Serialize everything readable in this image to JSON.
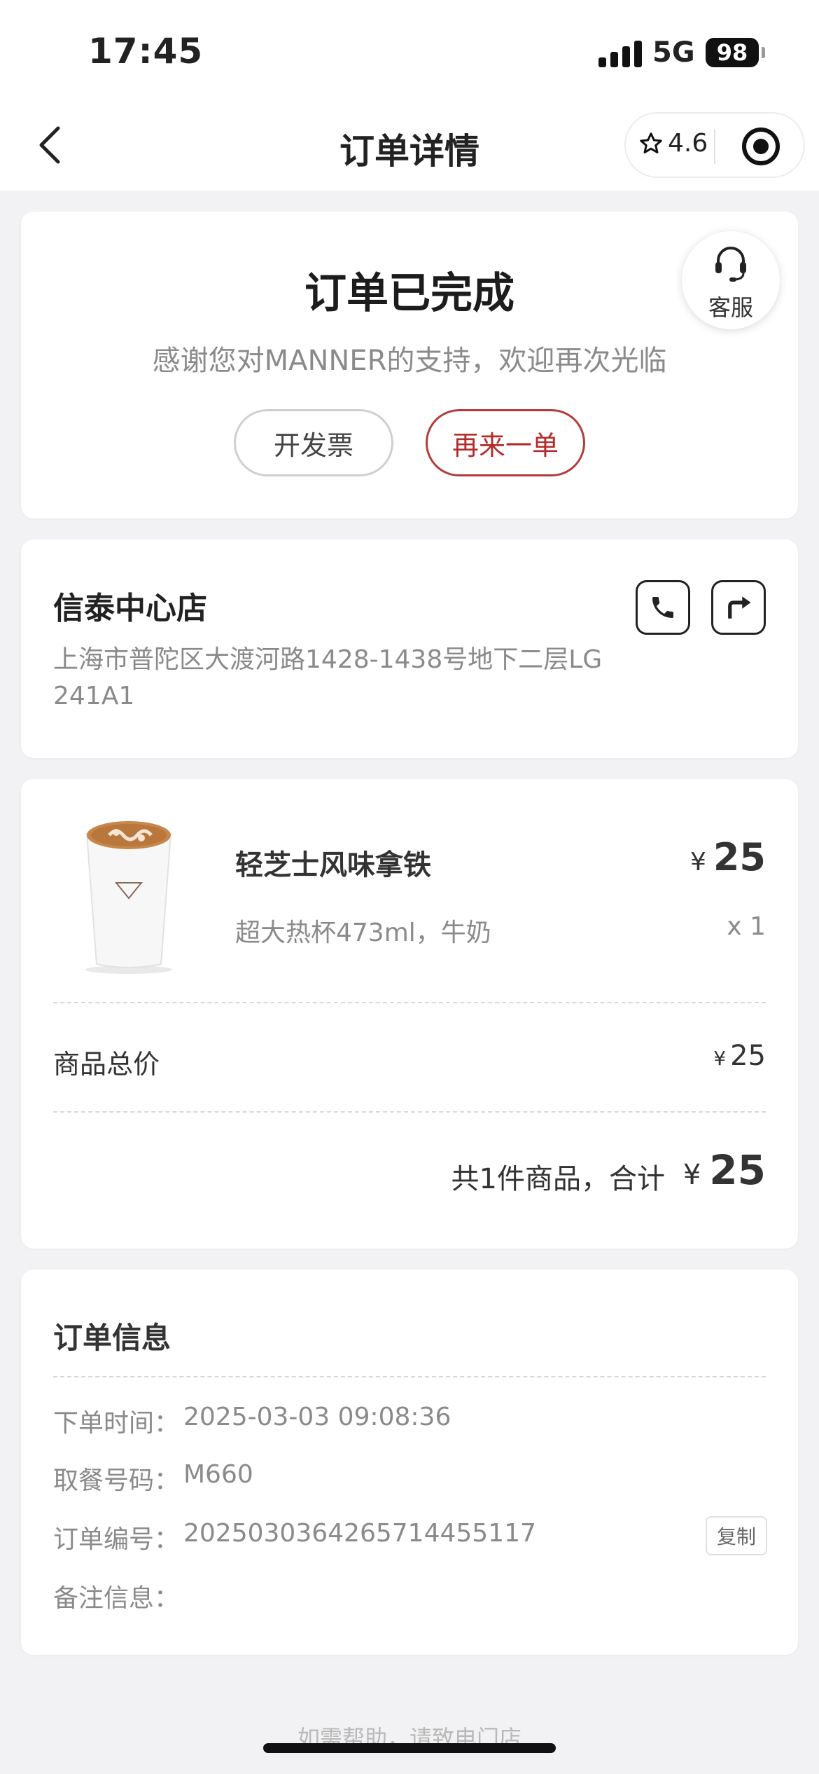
{
  "status_bar": {
    "time": "17:45",
    "network": "5G",
    "battery": "98"
  },
  "nav": {
    "title": "订单详情",
    "rating": "4.6"
  },
  "order_status": {
    "title": "订单已完成",
    "subtitle": "感谢您对MANNER的支持，欢迎再次光临",
    "invoice_label": "开发票",
    "reorder_label": "再来一单",
    "service_label": "客服"
  },
  "store": {
    "name": "信泰中心店",
    "address": "上海市普陀区大渡河路1428-1438号地下二层LG 241A1"
  },
  "product": {
    "name": "轻芝士风味拿铁",
    "currency": "¥",
    "price": "25",
    "spec": "超大热杯473ml，牛奶",
    "qty": "x 1"
  },
  "summary": {
    "subtotal_label": "商品总价",
    "subtotal_value": "25",
    "total_text": "共1件商品，合计",
    "total_value": "25"
  },
  "order_info": {
    "title": "订单信息",
    "rows": [
      {
        "label": "下单时间：",
        "value": "2025-03-03 09:08:36"
      },
      {
        "label": "取餐号码：",
        "value": "M660"
      },
      {
        "label": "订单编号：",
        "value": "20250303642657144551​17"
      },
      {
        "label": "备注信息：",
        "value": ""
      }
    ],
    "copy_label": "复制"
  },
  "footer": {
    "help_text": "如需帮助，请致电门店"
  },
  "colors": {
    "accent": "#b22c2c",
    "background": "#f2f2f4",
    "muted": "#8a8a8a"
  }
}
